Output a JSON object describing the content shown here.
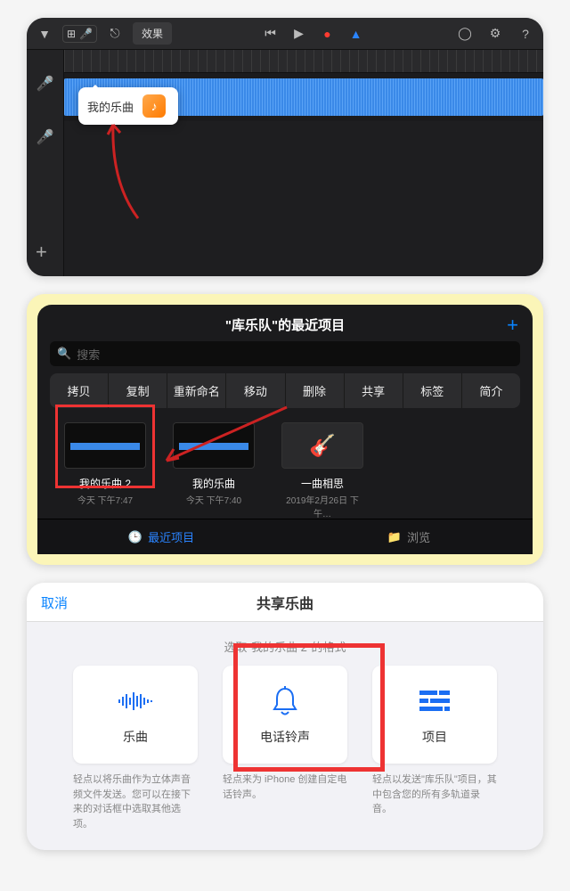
{
  "panel1": {
    "fx_label": "效果",
    "popover_title": "我的乐曲"
  },
  "panel2": {
    "title": "\"库乐队\"的最近项目",
    "search_placeholder": "搜索",
    "menu": [
      "拷贝",
      "复制",
      "重新命名",
      "移动",
      "删除",
      "共享",
      "标签",
      "简介"
    ],
    "items": [
      {
        "title": "我的乐曲 2",
        "subtitle": "今天 下午7:47"
      },
      {
        "title": "我的乐曲",
        "subtitle": "今天 下午7:40"
      },
      {
        "title": "一曲相思",
        "subtitle": "2019年2月26日 下午…"
      }
    ],
    "tab_recent": "最近项目",
    "tab_browse": "浏览"
  },
  "panel3": {
    "cancel": "取消",
    "title": "共享乐曲",
    "subtitle": "选取\"我的乐曲 2\"的格式",
    "cards": [
      {
        "label": "乐曲",
        "desc": "轻点以将乐曲作为立体声音频文件发送。您可以在接下来的对话框中选取其他选项。"
      },
      {
        "label": "电话铃声",
        "desc": "轻点来为 iPhone 创建自定电话铃声。"
      },
      {
        "label": "项目",
        "desc": "轻点以发送\"库乐队\"项目，其中包含您的所有多轨道录音。"
      }
    ]
  }
}
